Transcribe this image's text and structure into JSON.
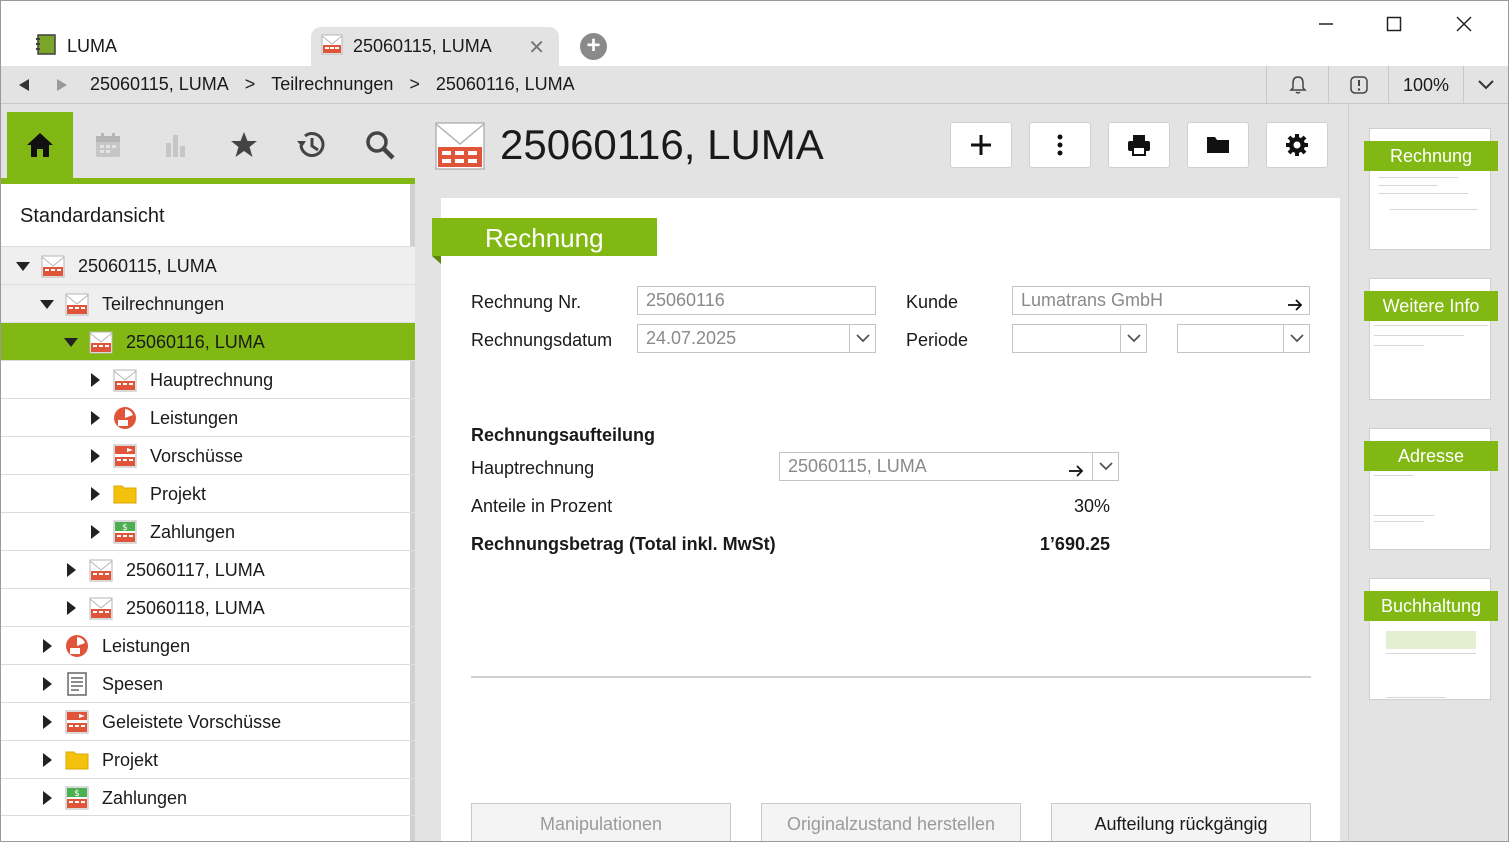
{
  "titlebar": {
    "tabs": [
      {
        "label": "LUMA"
      },
      {
        "label": "25060115, LUMA"
      }
    ]
  },
  "address": {
    "crumbs": [
      "25060115, LUMA",
      "Teilrechnungen",
      "25060116, LUMA"
    ],
    "separator": ">",
    "zoom": "100%"
  },
  "sidebar": {
    "view_title": "Standardansicht",
    "tree": [
      {
        "label": "25060115, LUMA"
      },
      {
        "label": "Teilrechnungen"
      },
      {
        "label": "25060116, LUMA"
      },
      {
        "label": "Hauptrechnung"
      },
      {
        "label": "Leistungen"
      },
      {
        "label": "Vorschüsse"
      },
      {
        "label": "Projekt"
      },
      {
        "label": "Zahlungen"
      },
      {
        "label": "25060117, LUMA"
      },
      {
        "label": "25060118, LUMA"
      },
      {
        "label": "Leistungen"
      },
      {
        "label": "Spesen"
      },
      {
        "label": "Geleistete Vorschüsse"
      },
      {
        "label": "Projekt"
      },
      {
        "label": "Zahlungen"
      }
    ]
  },
  "main": {
    "title": "25060116, LUMA",
    "section_tab": "Rechnung",
    "fields": {
      "rechnung_nr_label": "Rechnung Nr.",
      "rechnung_nr_value": "25060116",
      "rechnungsdatum_label": "Rechnungsdatum",
      "rechnungsdatum_value": "24.07.2025",
      "kunde_label": "Kunde",
      "kunde_value": "Lumatrans GmbH",
      "periode_label": "Periode",
      "periode_from": "",
      "periode_to": ""
    },
    "aufteilung": {
      "heading": "Rechnungsaufteilung",
      "hauptrechnung_label": "Hauptrechnung",
      "hauptrechnung_value": "25060115, LUMA",
      "anteile_label": "Anteile in Prozent",
      "anteile_value": "30%",
      "betrag_label": "Rechnungsbetrag (Total inkl. MwSt)",
      "betrag_value": "1’690.25"
    },
    "buttons": {
      "manipulationen": "Manipulationen",
      "originalzustand": "Originalzustand herstellen",
      "aufteilung_rueckgaengig": "Aufteilung rückgängig"
    }
  },
  "thumbnails": [
    {
      "label": "Rechnung"
    },
    {
      "label": "Weitere Info"
    },
    {
      "label": "Adresse"
    },
    {
      "label": "Buchhaltung"
    }
  ],
  "colors": {
    "accent": "#82b814",
    "background": "#e3e3e3",
    "icon_red": "#e0543a"
  }
}
